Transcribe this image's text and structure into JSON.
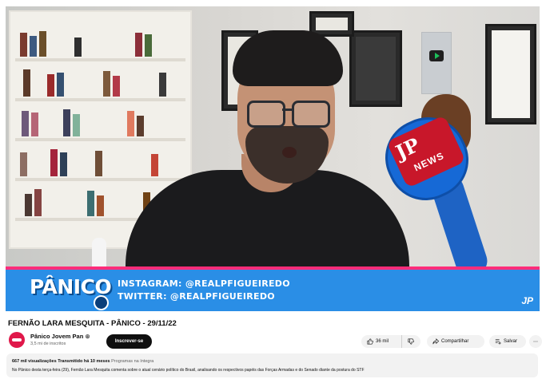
{
  "video": {
    "lower_third": {
      "logo": "PÂNICO",
      "instagram": "INSTAGRAM: @REALPFIGUEIREDO",
      "twitter": "TWITTER: @REALPFIGUEIREDO",
      "watermark": "JP"
    },
    "mic_flag": {
      "brand": "JP",
      "label": "NEWS"
    }
  },
  "meta": {
    "title": "FERNÃO LARA MESQUITA - PÂNICO - 29/11/22",
    "channel": {
      "name": "Pânico Jovem Pan",
      "verified_mark": "⊛",
      "subscribers": "3,5 mi de inscritos",
      "subscribe_label": "Inscrever-se"
    },
    "actions": {
      "likes": "36 mil",
      "share_label": "Compartilhar",
      "save_label": "Salvar",
      "more_label": "⋯"
    },
    "description": {
      "views": "667 mil visualizações",
      "streamed": "Transmitido há 10 meses",
      "tags": "Programas na íntegra",
      "text": "No Pânico desta terça-feira (29), Fernão Lara Mesquita comenta sobre o atual cenário político do Brasil, analisando os respectivos papéis das Forças Armadas e do Senado diante da postura do STF"
    }
  },
  "colors": {
    "banner": "#2a8ee6",
    "banner_accent": "#ff2d7a",
    "mic": "#1669d6",
    "mic_flag": "#c8172a",
    "subscribe_bg": "#0f0f0f"
  }
}
